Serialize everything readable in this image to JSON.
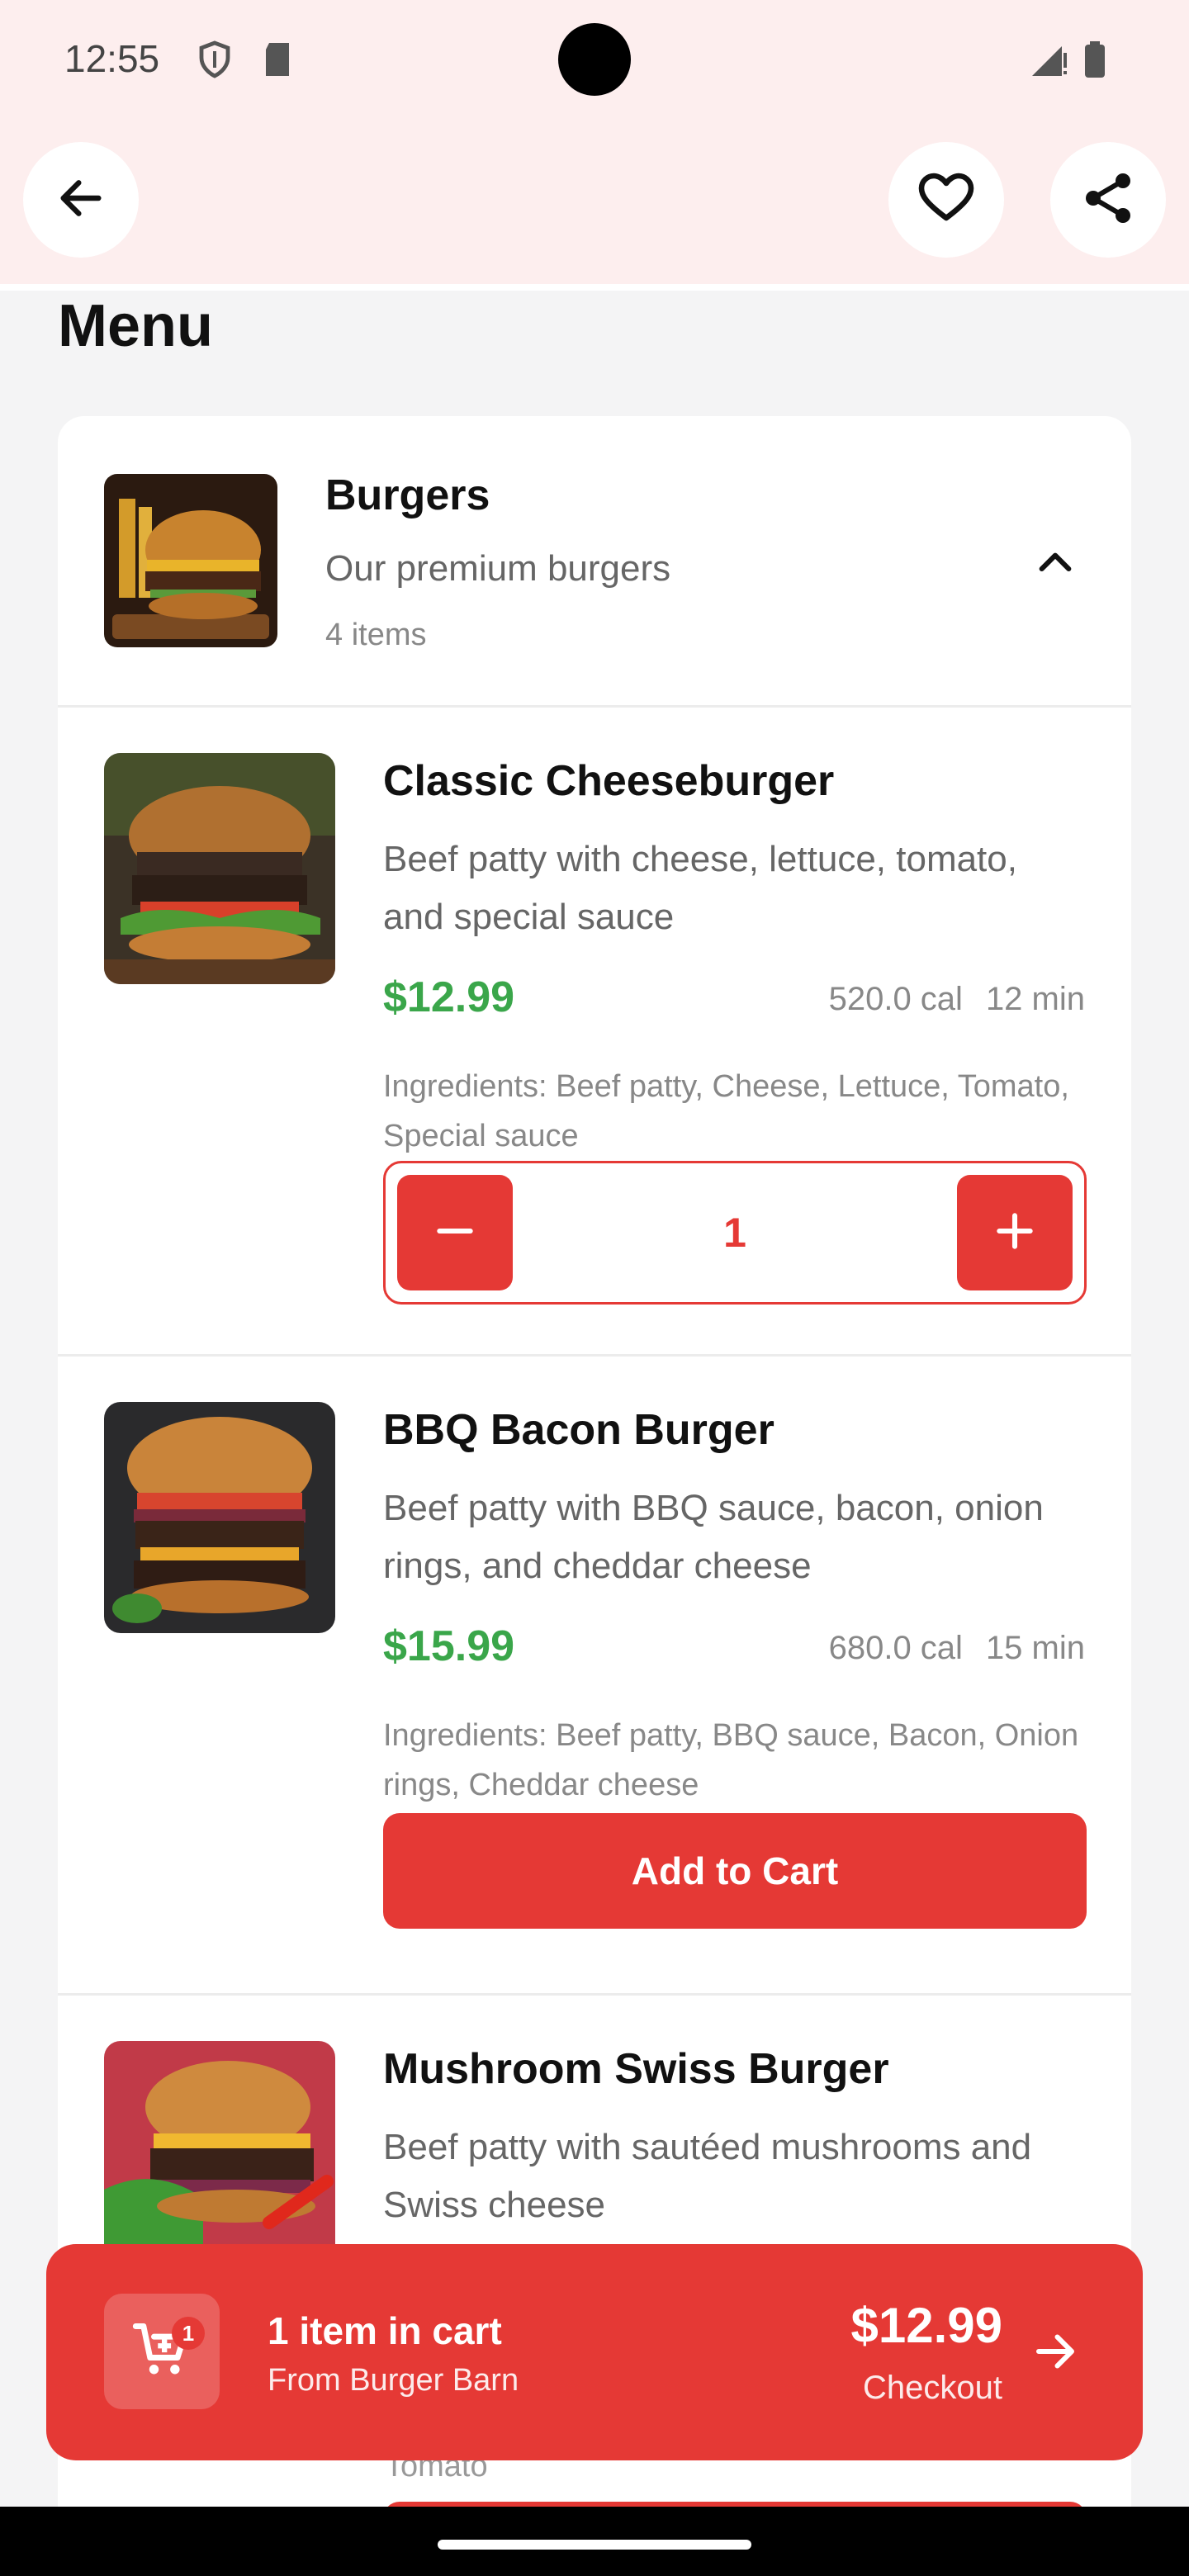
{
  "status_bar": {
    "time": "12:55",
    "icons": [
      "shield-icon",
      "sd-card-icon",
      "signal-icon",
      "battery-icon"
    ]
  },
  "app_bar": {
    "back_icon": "arrow-left-icon",
    "favorite_icon": "heart-outline-icon",
    "share_icon": "share-icon"
  },
  "page": {
    "title": "Menu"
  },
  "category": {
    "name": "Burgers",
    "description": "Our premium burgers",
    "count": "4 items",
    "collapse_icon": "chevron-up-icon"
  },
  "items": [
    {
      "name": "Classic Cheeseburger",
      "description": "Beef patty with cheese, lettuce, tomato, and special sauce",
      "price": "$12.99",
      "calories": "520.0 cal",
      "time": "12 min",
      "ingredients": "Ingredients: Beef patty, Cheese, Lettuce, Tomato, Special sauce",
      "quantity": "1"
    },
    {
      "name": "BBQ Bacon Burger",
      "description": "Beef patty with BBQ sauce, bacon, onion rings, and cheddar cheese",
      "price": "$15.99",
      "calories": "680.0 cal",
      "time": "15 min",
      "ingredients": "Ingredients: Beef patty, BBQ sauce, Bacon, Onion rings, Cheddar cheese",
      "button_label": "Add to Cart"
    },
    {
      "name": "Mushroom Swiss Burger",
      "description": "Beef patty with sautéed mushrooms and Swiss cheese",
      "partial_text": "Tomato"
    }
  ],
  "cart": {
    "badge": "1",
    "summary": "1 item in cart",
    "restaurant": "From Burger Barn",
    "total": "$12.99",
    "checkout_label": "Checkout"
  },
  "colors": {
    "accent": "#e53935",
    "price": "#3aa64a",
    "header_bg": "#fdeeee"
  }
}
